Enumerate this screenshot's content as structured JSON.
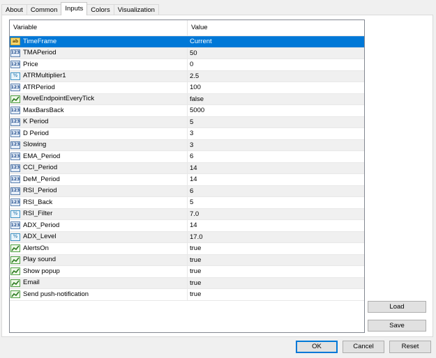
{
  "tabs": [
    {
      "label": "About",
      "active": false
    },
    {
      "label": "Common",
      "active": false
    },
    {
      "label": "Inputs",
      "active": true
    },
    {
      "label": "Colors",
      "active": false
    },
    {
      "label": "Visualization",
      "active": false
    }
  ],
  "grid": {
    "headers": {
      "variable": "Variable",
      "value": "Value"
    },
    "selected_row": 0,
    "icon_labels": {
      "str": "ab",
      "int": "123",
      "dbl": "½"
    },
    "rows": [
      {
        "variable": "TimeFrame",
        "value": "Current",
        "type": "str"
      },
      {
        "variable": "TMAPeriod",
        "value": "50",
        "type": "int"
      },
      {
        "variable": "Price",
        "value": "0",
        "type": "int"
      },
      {
        "variable": "ATRMultiplier1",
        "value": "2.5",
        "type": "dbl"
      },
      {
        "variable": "ATRPeriod",
        "value": "100",
        "type": "int"
      },
      {
        "variable": "MoveEndpointEveryTick",
        "value": "false",
        "type": "bool"
      },
      {
        "variable": "MaxBarsBack",
        "value": "5000",
        "type": "int"
      },
      {
        "variable": "K Period",
        "value": "5",
        "type": "int"
      },
      {
        "variable": "D Period",
        "value": "3",
        "type": "int"
      },
      {
        "variable": "Slowing",
        "value": "3",
        "type": "int"
      },
      {
        "variable": "EMA_Period",
        "value": "6",
        "type": "int"
      },
      {
        "variable": "CCI_Period",
        "value": "14",
        "type": "int"
      },
      {
        "variable": "DeM_Period",
        "value": "14",
        "type": "int"
      },
      {
        "variable": "RSI_Period",
        "value": "6",
        "type": "int"
      },
      {
        "variable": "RSI_Back",
        "value": "5",
        "type": "int"
      },
      {
        "variable": "RSI_Filter",
        "value": "7.0",
        "type": "dbl"
      },
      {
        "variable": "ADX_Period",
        "value": "14",
        "type": "int"
      },
      {
        "variable": "ADX_Level",
        "value": "17.0",
        "type": "dbl"
      },
      {
        "variable": "AlertsOn",
        "value": "true",
        "type": "bool"
      },
      {
        "variable": "Play sound",
        "value": "true",
        "type": "bool"
      },
      {
        "variable": "Show popup",
        "value": "true",
        "type": "bool"
      },
      {
        "variable": "Email",
        "value": "true",
        "type": "bool"
      },
      {
        "variable": "Send push-notification",
        "value": "true",
        "type": "bool"
      }
    ]
  },
  "side_buttons": {
    "load": "Load",
    "save": "Save"
  },
  "footer": {
    "ok": "OK",
    "cancel": "Cancel",
    "reset": "Reset"
  },
  "colors": {
    "selection": "#0078d7",
    "alt_row": "#f0f0f0"
  }
}
